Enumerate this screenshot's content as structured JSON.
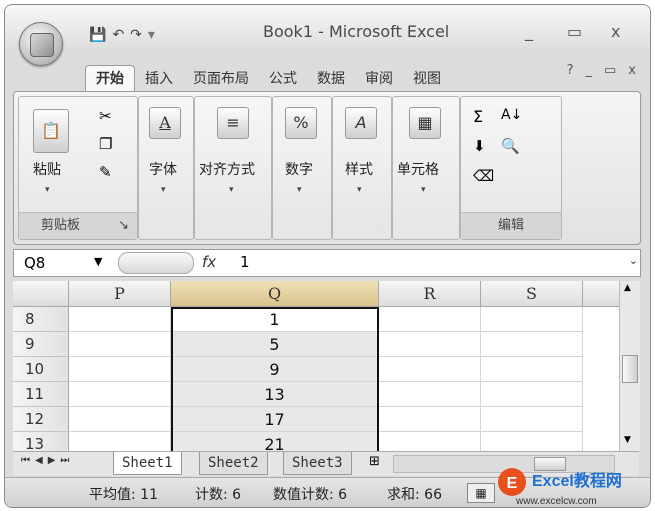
{
  "window": {
    "title": "Book1 - Microsoft Excel",
    "minimize": "_",
    "restore": "▭",
    "close": "x"
  },
  "qat": {
    "save_icon": "save-icon",
    "undo_icon": "undo-icon",
    "redo_icon": "redo-icon",
    "custom_arrow": "▾"
  },
  "ribbon_tabs": [
    "开始",
    "插入",
    "页面布局",
    "公式",
    "数据",
    "审阅",
    "视图"
  ],
  "ribbon": {
    "clipboard": {
      "paste_label": "粘贴",
      "group_label": "剪贴板"
    },
    "font": {
      "label": "字体",
      "icon_text": "A"
    },
    "align": {
      "label": "对齐方式",
      "icon_text": "≡"
    },
    "number": {
      "label": "数字",
      "icon_text": "%"
    },
    "styles": {
      "label": "样式",
      "icon_text": "A"
    },
    "cells": {
      "label": "单元格"
    },
    "editing": {
      "group_label": "编辑",
      "sum": "Σ",
      "sort": "A↓"
    }
  },
  "formula": {
    "name_box": "Q8",
    "fx": "fx",
    "value": "1"
  },
  "columns": [
    "P",
    "Q",
    "R",
    "S"
  ],
  "rows": [
    {
      "num": "8",
      "q": "1"
    },
    {
      "num": "9",
      "q": "5"
    },
    {
      "num": "10",
      "q": "9"
    },
    {
      "num": "11",
      "q": "13"
    },
    {
      "num": "12",
      "q": "17"
    },
    {
      "num": "13",
      "q": "21"
    }
  ],
  "sheets": [
    "Sheet1",
    "Sheet2",
    "Sheet3"
  ],
  "status": {
    "avg": "平均值: 11",
    "count": "计数: 6",
    "num_count": "数值计数: 6",
    "sum": "求和: 66"
  },
  "watermark": {
    "brand": "Excel教程网",
    "url": "www.excelcw.com"
  }
}
